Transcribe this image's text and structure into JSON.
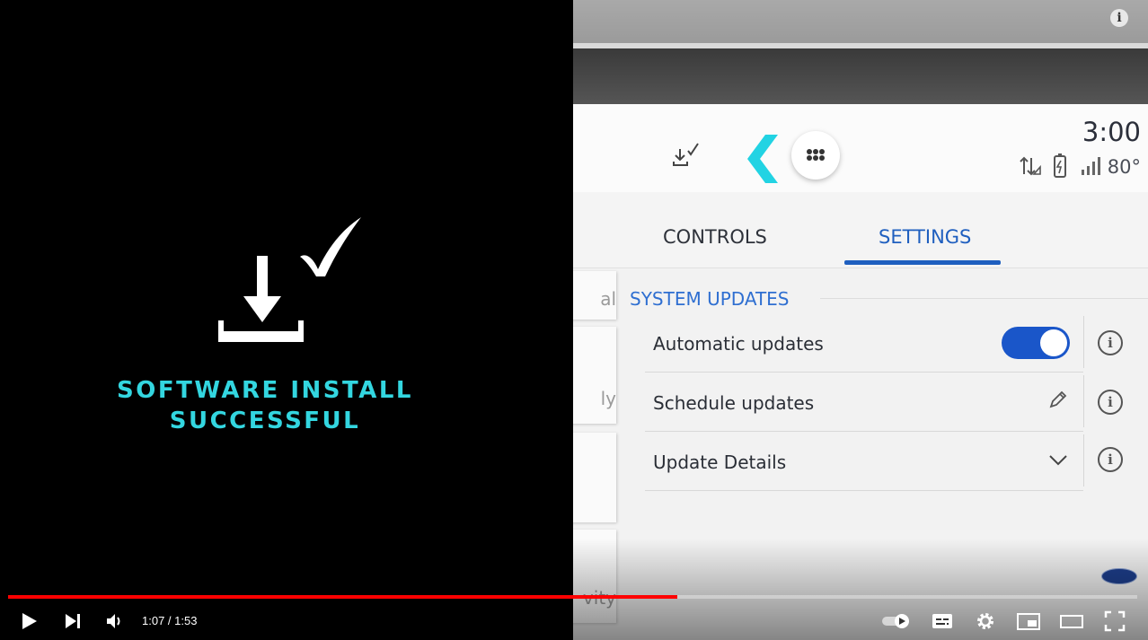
{
  "left_panel": {
    "message_line1": "SOFTWARE INSTALL",
    "message_line2": "SUCCESSFUL",
    "accent_color": "#33d6e0",
    "icon": "download-complete-icon"
  },
  "infotainment": {
    "status_bar": {
      "time": "3:00",
      "temperature": "80°",
      "icons": [
        "download-check-icon",
        "back-chevron-icon",
        "apps-grid-icon",
        "data-transfer-icon",
        "phone-battery-icon",
        "signal-icon"
      ]
    },
    "tabs": [
      {
        "label": "CONTROLS",
        "active": false
      },
      {
        "label": "SETTINGS",
        "active": true
      }
    ],
    "side_menu_fragments": [
      "al",
      "ly",
      "vity"
    ],
    "section_title": "SYSTEM UPDATES",
    "rows": [
      {
        "label": "Automatic updates",
        "control": "toggle",
        "on": true
      },
      {
        "label": "Schedule updates",
        "control": "edit-pencil"
      },
      {
        "label": "Update Details",
        "control": "chevron-down"
      }
    ],
    "brand_logo_text": "Ford",
    "accent_blue": "#1f5fbf"
  },
  "video_player": {
    "current_time": "1:07",
    "duration": "1:53",
    "time_display": "1:07 / 1:53",
    "progress": 0.593,
    "progress_color": "#ff0000",
    "autoplay_on": true,
    "info_icon": "i"
  }
}
